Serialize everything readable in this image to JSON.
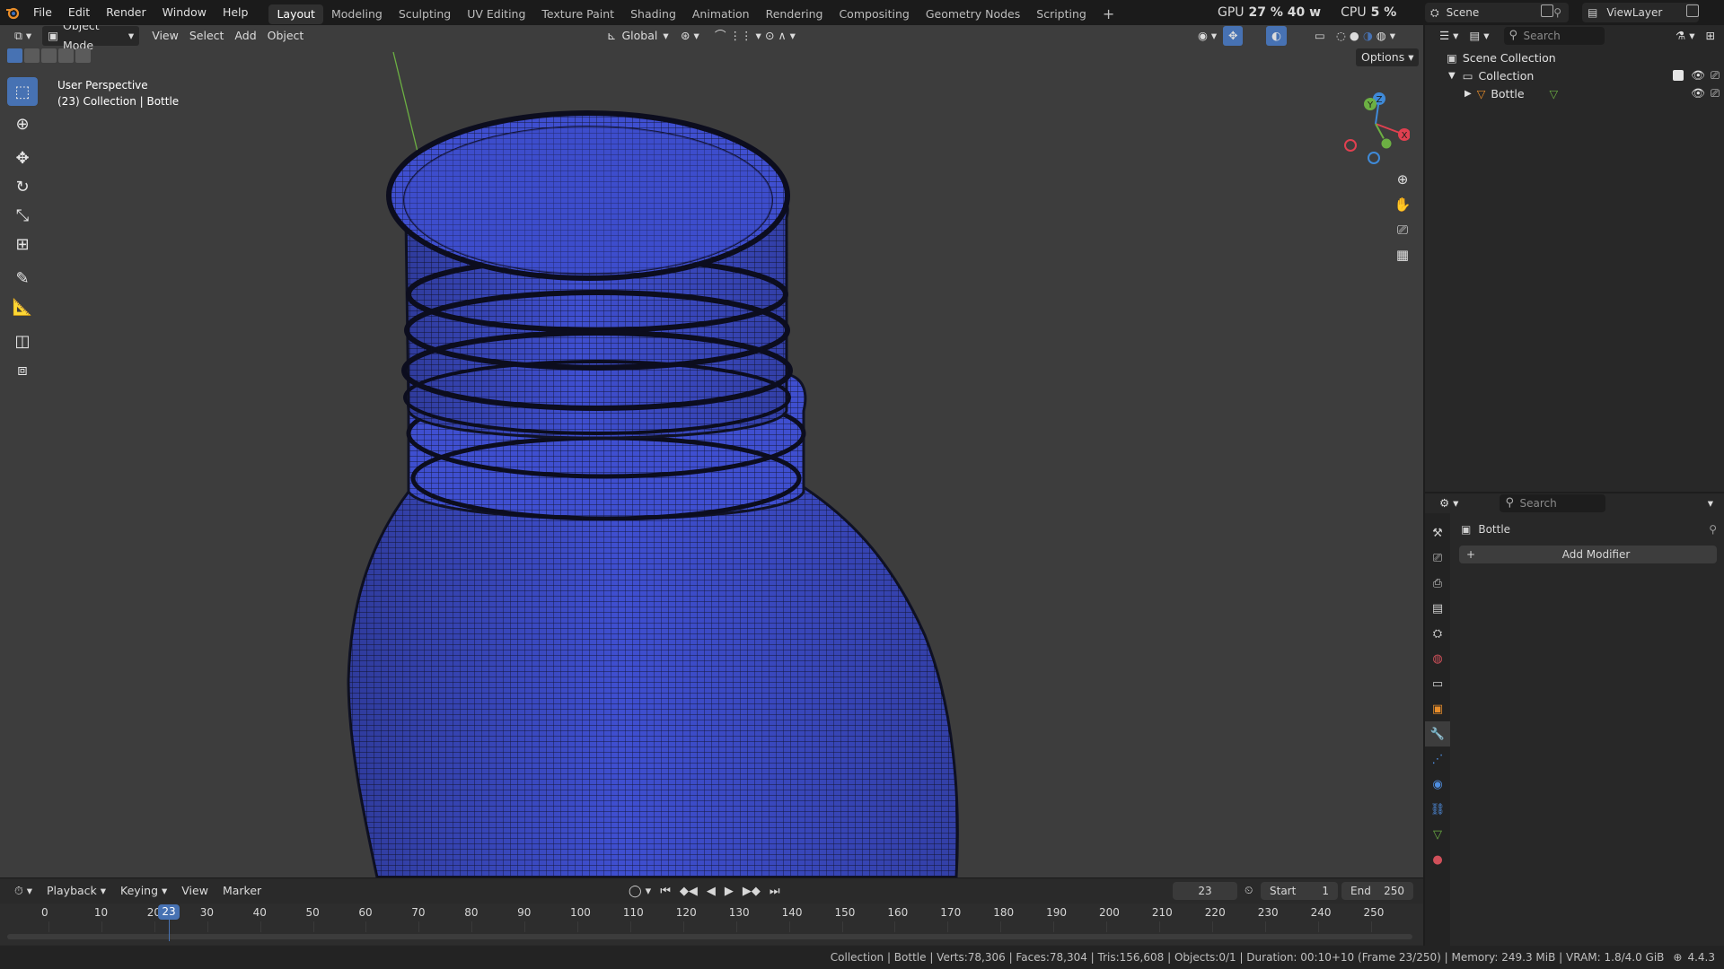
{
  "app": {
    "menus": [
      "File",
      "Edit",
      "Render",
      "Window",
      "Help"
    ],
    "workspaces": [
      "Layout",
      "Modeling",
      "Sculpting",
      "UV Editing",
      "Texture Paint",
      "Shading",
      "Animation",
      "Rendering",
      "Compositing",
      "Geometry Nodes",
      "Scripting"
    ],
    "active_workspace": "Layout",
    "gpu_label": "GPU",
    "gpu_value": "27 % 40 w",
    "cpu_label": "CPU",
    "cpu_value": "5 %",
    "scene_name": "Scene",
    "view_layer": "ViewLayer"
  },
  "viewport": {
    "mode": "Object Mode",
    "menus": [
      "View",
      "Select",
      "Add",
      "Object"
    ],
    "orientation": "Global",
    "options_label": "Options",
    "overlay_title": "User Perspective",
    "overlay_subtitle": "(23) Collection | Bottle",
    "mesh_color": "#3f4fd0",
    "gizmo_axes": [
      "Z",
      "Y",
      "X"
    ]
  },
  "outliner": {
    "search_placeholder": "Search",
    "scene_collection": "Scene Collection",
    "collection": "Collection",
    "object": "Bottle"
  },
  "properties": {
    "search_placeholder": "Search",
    "object_name": "Bottle",
    "add_modifier": "Add Modifier"
  },
  "timeline": {
    "menus": [
      "Playback",
      "Keying",
      "View",
      "Marker"
    ],
    "current_frame": "23",
    "start_label": "Start",
    "start_value": "1",
    "end_label": "End",
    "end_value": "250",
    "ticks": [
      "0",
      "10",
      "20",
      "30",
      "40",
      "50",
      "60",
      "70",
      "80",
      "90",
      "100",
      "110",
      "120",
      "130",
      "140",
      "150",
      "160",
      "170",
      "180",
      "190",
      "200",
      "210",
      "220",
      "230",
      "240",
      "250"
    ]
  },
  "status": {
    "text": "Collection | Bottle | Verts:78,306 | Faces:78,304 | Tris:156,608 | Objects:0/1 | Duration: 00:10+10 (Frame 23/250) | Memory: 249.3 MiB | VRAM: 1.8/4.0 GiB",
    "version": "4.4.3"
  },
  "colors": {
    "accent": "#4772b3",
    "playhead": "#4772b3",
    "axis_x": "#e04050",
    "axis_y": "#6cb043",
    "axis_z": "#3f8ad8"
  }
}
